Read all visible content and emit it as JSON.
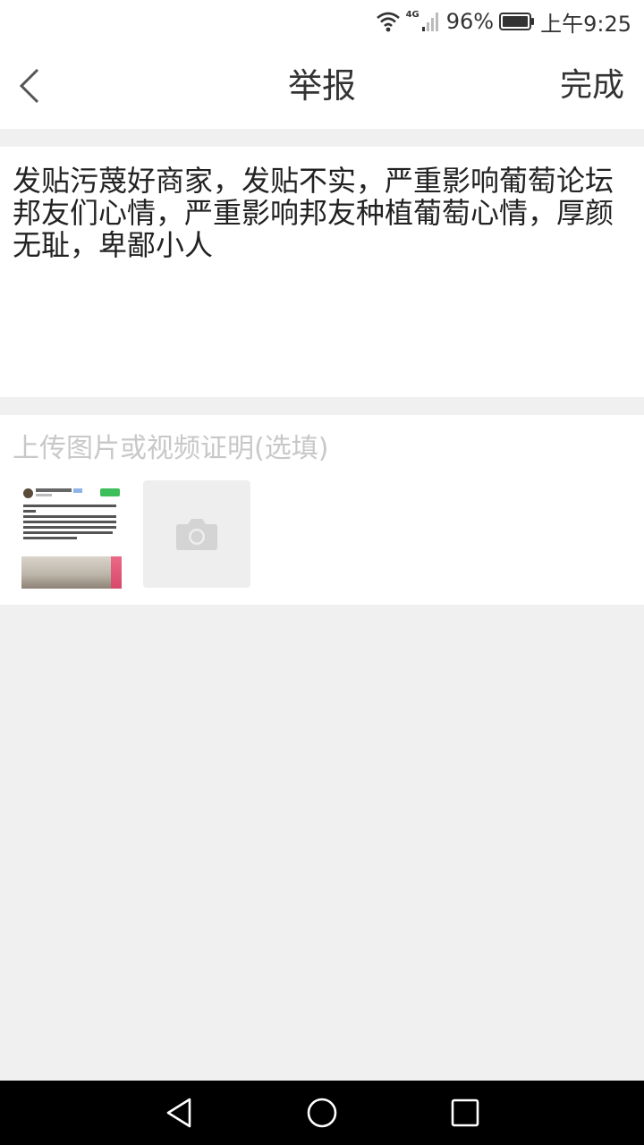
{
  "status_bar": {
    "network": "4G",
    "battery": "96%",
    "time": "上午9:25"
  },
  "header": {
    "title": "举报",
    "done_label": "完成"
  },
  "report": {
    "text": "发贴污蔑好商家，发贴不实，严重影响葡萄论坛邦友们心情，严重影响邦友种植葡萄心情，厚颜无耻，卑鄙小人"
  },
  "upload": {
    "placeholder": "上传图片或视频证明(选填)"
  },
  "colors": {
    "background": "#f0f0f0",
    "surface": "#ffffff",
    "text": "#333333",
    "hint": "#c8c8c8",
    "nav_bar": "#000000"
  },
  "icons": {
    "back": "chevron-left-icon",
    "camera": "camera-icon",
    "wifi": "wifi-icon",
    "signal": "signal-icon",
    "battery": "battery-icon",
    "nav_back": "triangle-back-icon",
    "nav_home": "circle-home-icon",
    "nav_recents": "square-recents-icon"
  }
}
